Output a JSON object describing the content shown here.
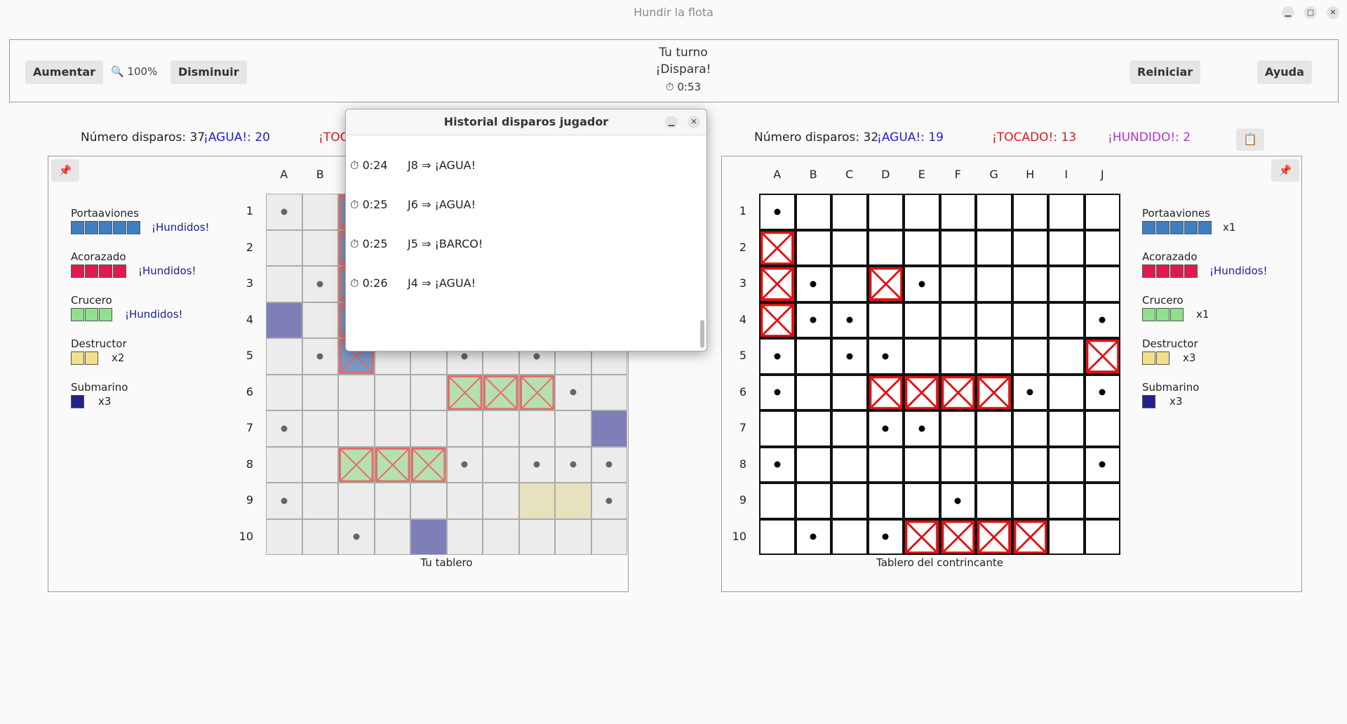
{
  "window": {
    "title": "Hundir la flota"
  },
  "toolbar": {
    "zoom_in": "Aumentar",
    "zoom_icon": "🔍",
    "zoom_level": "100%",
    "zoom_out": "Disminuir",
    "turn_line1": "Tu turno",
    "turn_line2": "¡Dispara!",
    "timer_icon": "⏱",
    "timer": "0:53",
    "restart": "Reiniciar",
    "help": "Ayuda"
  },
  "left_stats": {
    "shots_label": "Número disparos: 37",
    "water": "¡AGUA!: 20",
    "hit_partial": "¡TOC"
  },
  "right_stats": {
    "shots_label": "Número disparos: 32",
    "water": "¡AGUA!: 19",
    "hit": "¡TOCADO!: 13",
    "sunk": "¡HUNDIDO!: 2"
  },
  "icons": {
    "pin": "📌",
    "clipboard": "📋"
  },
  "columns": [
    "A",
    "B",
    "C",
    "D",
    "E",
    "F",
    "G",
    "H",
    "I",
    "J"
  ],
  "rows": [
    "1",
    "2",
    "3",
    "4",
    "5",
    "6",
    "7",
    "8",
    "9",
    "10"
  ],
  "left_legend": [
    {
      "name": "Portaaviones",
      "size": 5,
      "color": "#3d7fc0",
      "status": "¡Hundidos!",
      "status_color": "#1a1a9a"
    },
    {
      "name": "Acorazado",
      "size": 4,
      "color": "#e01a4f",
      "status": "¡Hundidos!",
      "status_color": "#1a1a9a"
    },
    {
      "name": "Crucero",
      "size": 3,
      "color": "#90e08e",
      "status": "¡Hundidos!",
      "status_color": "#1a1a9a"
    },
    {
      "name": "Destructor",
      "size": 2,
      "color": "#f0e08c",
      "status": "x2",
      "status_color": "#222"
    },
    {
      "name": "Submarino",
      "size": 1,
      "color": "#22228a",
      "status": "x3",
      "status_color": "#222"
    }
  ],
  "right_legend": [
    {
      "name": "Portaaviones",
      "size": 5,
      "color": "#3d7fc0",
      "status": "x1",
      "status_color": "#222"
    },
    {
      "name": "Acorazado",
      "size": 4,
      "color": "#e01a4f",
      "status": "¡Hundidos!",
      "status_color": "#1a1a9a"
    },
    {
      "name": "Crucero",
      "size": 3,
      "color": "#90e08e",
      "status": "x1",
      "status_color": "#222"
    },
    {
      "name": "Destructor",
      "size": 2,
      "color": "#f0e08c",
      "status": "x3",
      "status_color": "#222"
    },
    {
      "name": "Submarino",
      "size": 1,
      "color": "#22228a",
      "status": "x3",
      "status_color": "#222"
    }
  ],
  "left_board": {
    "caption": "Tu tablero",
    "ship_cells": [
      {
        "r": 0,
        "c": 2,
        "color": "#7a9ac6"
      },
      {
        "r": 1,
        "c": 2,
        "color": "#7a9ac6"
      },
      {
        "r": 2,
        "c": 2,
        "color": "#7a9ac6"
      },
      {
        "r": 3,
        "c": 2,
        "color": "#7a9ac6"
      },
      {
        "r": 4,
        "c": 2,
        "color": "#7a9ac6"
      },
      {
        "r": 5,
        "c": 5,
        "color": "#b5e0b0"
      },
      {
        "r": 5,
        "c": 6,
        "color": "#b5e0b0"
      },
      {
        "r": 5,
        "c": 7,
        "color": "#b5e0b0"
      },
      {
        "r": 7,
        "c": 2,
        "color": "#b5e0b0"
      },
      {
        "r": 7,
        "c": 3,
        "color": "#b5e0b0"
      },
      {
        "r": 7,
        "c": 4,
        "color": "#b5e0b0"
      },
      {
        "r": 3,
        "c": 0,
        "color": "#7e7eb8"
      },
      {
        "r": 6,
        "c": 9,
        "color": "#7e7eb8"
      },
      {
        "r": 9,
        "c": 4,
        "color": "#7e7eb8"
      },
      {
        "r": 8,
        "c": 7,
        "color": "#e6e2be"
      },
      {
        "r": 8,
        "c": 8,
        "color": "#e6e2be"
      }
    ],
    "hits": [
      {
        "r": 0,
        "c": 2
      },
      {
        "r": 1,
        "c": 2
      },
      {
        "r": 2,
        "c": 2
      },
      {
        "r": 3,
        "c": 2
      },
      {
        "r": 4,
        "c": 2
      },
      {
        "r": 5,
        "c": 5
      },
      {
        "r": 5,
        "c": 6
      },
      {
        "r": 5,
        "c": 7
      },
      {
        "r": 7,
        "c": 2
      },
      {
        "r": 7,
        "c": 3
      },
      {
        "r": 7,
        "c": 4
      }
    ],
    "misses": [
      {
        "r": 0,
        "c": 0
      },
      {
        "r": 2,
        "c": 1
      },
      {
        "r": 4,
        "c": 1
      },
      {
        "r": 4,
        "c": 5
      },
      {
        "r": 4,
        "c": 7
      },
      {
        "r": 5,
        "c": 8
      },
      {
        "r": 6,
        "c": 0
      },
      {
        "r": 7,
        "c": 5
      },
      {
        "r": 7,
        "c": 7
      },
      {
        "r": 7,
        "c": 8
      },
      {
        "r": 7,
        "c": 9
      },
      {
        "r": 8,
        "c": 0
      },
      {
        "r": 8,
        "c": 9
      },
      {
        "r": 9,
        "c": 2
      }
    ]
  },
  "right_board": {
    "caption": "Tablero del contrincante",
    "hits": [
      {
        "r": 1,
        "c": 0
      },
      {
        "r": 2,
        "c": 0
      },
      {
        "r": 3,
        "c": 0
      },
      {
        "r": 2,
        "c": 3
      },
      {
        "r": 4,
        "c": 9
      },
      {
        "r": 5,
        "c": 3
      },
      {
        "r": 5,
        "c": 4
      },
      {
        "r": 5,
        "c": 5
      },
      {
        "r": 5,
        "c": 6
      },
      {
        "r": 9,
        "c": 4
      },
      {
        "r": 9,
        "c": 5
      },
      {
        "r": 9,
        "c": 6
      },
      {
        "r": 9,
        "c": 7
      }
    ],
    "misses": [
      {
        "r": 0,
        "c": 0
      },
      {
        "r": 2,
        "c": 1
      },
      {
        "r": 2,
        "c": 4
      },
      {
        "r": 3,
        "c": 1
      },
      {
        "r": 3,
        "c": 2
      },
      {
        "r": 3,
        "c": 9
      },
      {
        "r": 4,
        "c": 0
      },
      {
        "r": 4,
        "c": 2
      },
      {
        "r": 4,
        "c": 3
      },
      {
        "r": 5,
        "c": 0
      },
      {
        "r": 5,
        "c": 7
      },
      {
        "r": 5,
        "c": 9
      },
      {
        "r": 6,
        "c": 3
      },
      {
        "r": 6,
        "c": 4
      },
      {
        "r": 7,
        "c": 0
      },
      {
        "r": 7,
        "c": 9
      },
      {
        "r": 8,
        "c": 5
      },
      {
        "r": 9,
        "c": 1
      },
      {
        "r": 9,
        "c": 3
      }
    ]
  },
  "history_dialog": {
    "title": "Historial disparos jugador",
    "entries": [
      {
        "time": "0:24",
        "shot": "J8 ⇒ ¡AGUA!"
      },
      {
        "time": "0:25",
        "shot": "J6 ⇒ ¡AGUA!"
      },
      {
        "time": "0:25",
        "shot": "J5 ⇒ ¡BARCO!"
      },
      {
        "time": "0:26",
        "shot": "J4 ⇒ ¡AGUA!"
      }
    ]
  },
  "colors": {
    "hit_stroke_left": "#e86a6a",
    "hit_stroke_right": "#e01010"
  }
}
